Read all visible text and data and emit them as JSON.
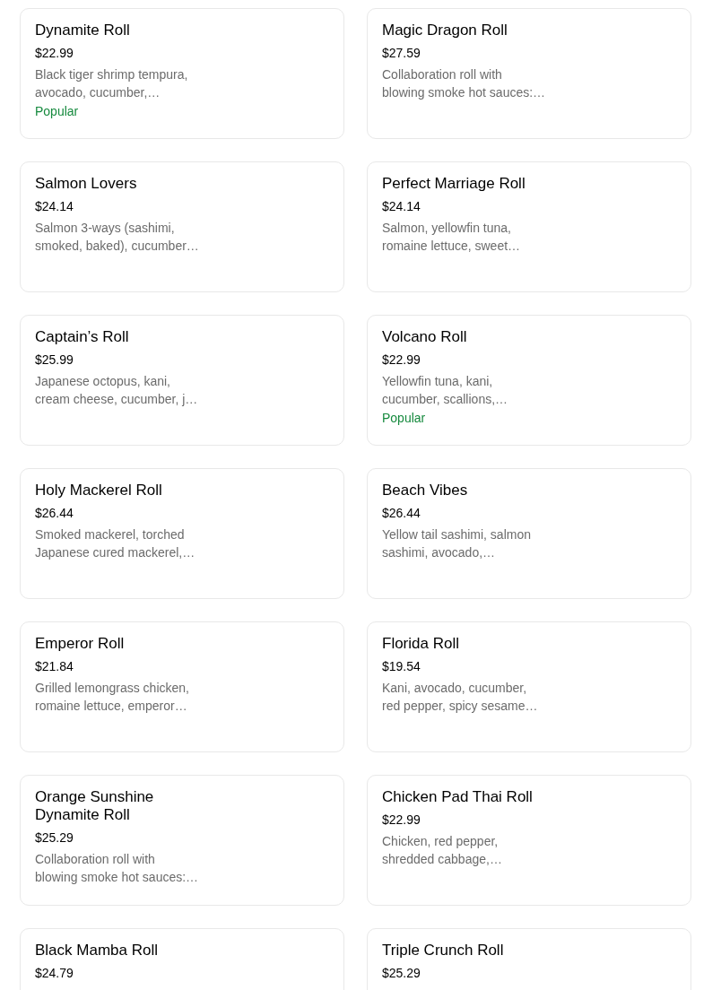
{
  "items": [
    {
      "name": "Dynamite Roll",
      "price": "$22.99",
      "description": [
        "Black tiger shrimp tempura,",
        "avocado, cucumber,…"
      ],
      "badge": "Popular"
    },
    {
      "name": "Magic Dragon Roll",
      "price": "$27.59",
      "description": [
        "Collaboration roll with",
        "blowing smoke hot sauces:…"
      ]
    },
    {
      "name": "Salmon Lovers",
      "price": "$24.14",
      "description": [
        "Salmon 3-ways (sashimi,",
        "smoked, baked), cucumber…"
      ]
    },
    {
      "name": "Perfect Marriage Roll",
      "price": "$24.14",
      "description": [
        "Salmon, yellowfin tuna,",
        "romaine lettuce, sweet…"
      ]
    },
    {
      "name": "Captain’s Roll",
      "price": "$25.99",
      "description": [
        "Japanese octopus, kani,",
        "cream cheese, cucumber, j…"
      ]
    },
    {
      "name": "Volcano Roll",
      "price": "$22.99",
      "description": [
        "Yellowfin tuna, kani,",
        "cucumber, scallions,…"
      ],
      "badge": "Popular"
    },
    {
      "name": "Holy Mackerel Roll",
      "price": "$26.44",
      "description": [
        "Smoked mackerel, torched",
        "Japanese cured mackerel,…"
      ]
    },
    {
      "name": "Beach Vibes",
      "price": "$26.44",
      "description": [
        "Yellow tail sashimi, salmon",
        "sashimi, avocado,…"
      ]
    },
    {
      "name": "Emperor Roll",
      "price": "$21.84",
      "description": [
        "Grilled lemongrass chicken,",
        "romaine lettuce, emperor…"
      ]
    },
    {
      "name": "Florida Roll",
      "price": "$19.54",
      "description": [
        "Kani, avocado, cucumber,",
        "red pepper, spicy sesame…"
      ]
    },
    {
      "name": "Orange Sunshine Dynamite Roll",
      "price": "$25.29",
      "description": [
        "Collaboration roll with",
        "blowing smoke hot sauces:…"
      ]
    },
    {
      "name": "Chicken Pad Thai Roll",
      "price": "$22.99",
      "description": [
        "Chicken, red pepper,",
        "shredded cabbage,…"
      ]
    },
    {
      "name": "Black Mamba Roll",
      "price": "$24.79"
    },
    {
      "name": "Triple Crunch Roll",
      "price": "$25.29"
    }
  ]
}
